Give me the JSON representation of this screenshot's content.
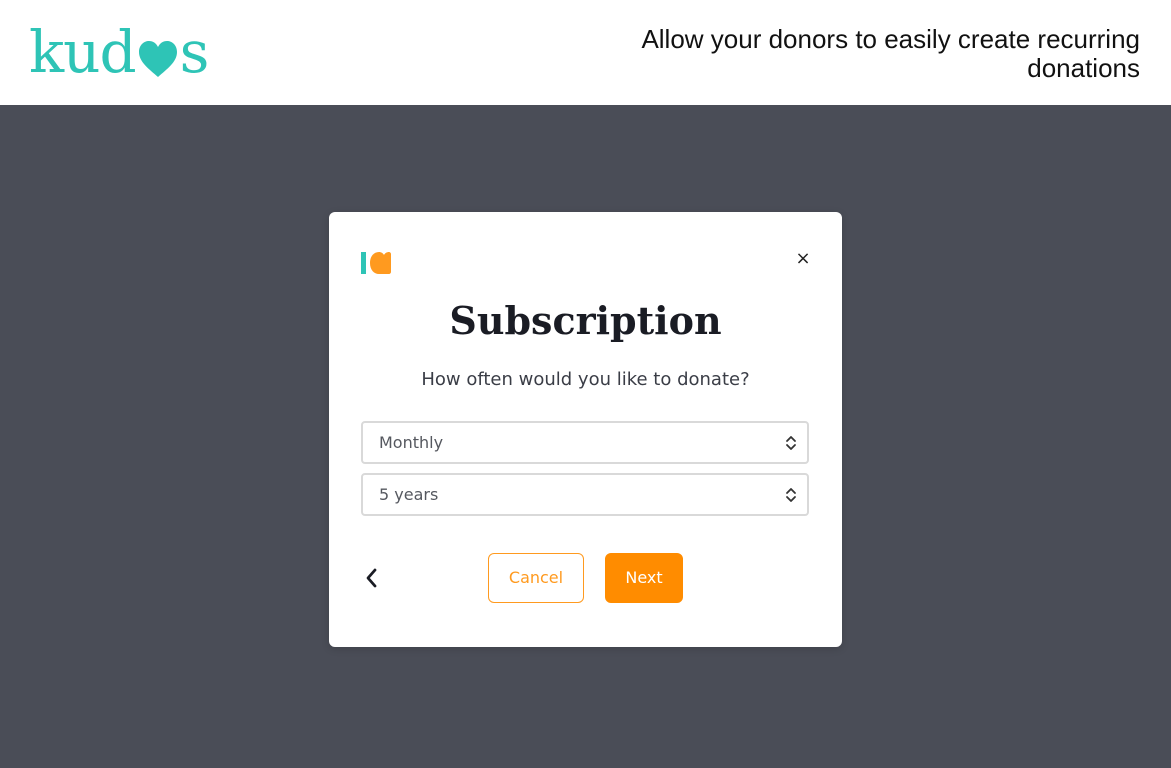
{
  "header": {
    "brand": {
      "prefix": "kud",
      "suffix": "s",
      "heart_icon": "heart-icon",
      "color": "#2ec4b6"
    },
    "tagline": "Allow your donors to easily create recurring donations"
  },
  "modal": {
    "logo_icon": "kudos-logo-icon",
    "close_label": "×",
    "title": "Subscription",
    "question": "How often would you like to donate?",
    "frequency_select": {
      "value": "Monthly"
    },
    "duration_select": {
      "value": "5 years"
    },
    "back_icon": "chevron-left-icon",
    "cancel_label": "Cancel",
    "next_label": "Next"
  },
  "colors": {
    "brand_teal": "#2ec4b6",
    "accent_orange": "#ff8c00",
    "overlay": "#4a4d57",
    "text_dark": "#1a1c24"
  }
}
